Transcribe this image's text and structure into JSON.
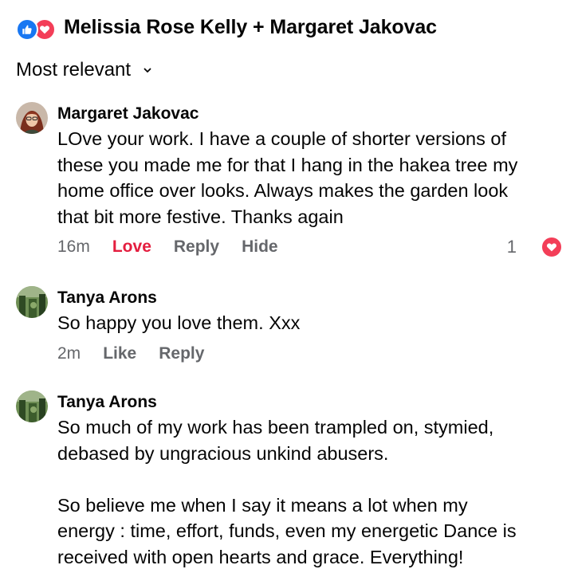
{
  "header": {
    "reactors": "Melissia Rose Kelly + Margaret Jakovac",
    "sort_label": "Most relevant",
    "icons": [
      "like-icon",
      "love-icon",
      "chevron-down-icon"
    ]
  },
  "comments": [
    {
      "author": "Margaret Jakovac",
      "text": "LOve your work. I have a couple of shorter versions of\nthese you made me for that I hang in the hakea tree my\nhome office over looks.  Always makes the garden look\nthat bit more festive. Thanks again",
      "time": "16m",
      "reaction_label": "Love",
      "reply_label": "Reply",
      "hide_label": "Hide",
      "reaction_count": "1"
    },
    {
      "author": "Tanya Arons",
      "text": "So happy you love them.  Xxx",
      "time": "2m",
      "reaction_label": "Like",
      "reply_label": "Reply"
    },
    {
      "author": "Tanya Arons",
      "text": "So much of my work has been trampled on, stymied,\ndebased by ungracious unkind abusers.\n\nSo believe me when I  say it means a lot when my\nenergy : time, effort, funds, even my energetic Dance is\nreceived with open hearts and grace. Everything!"
    }
  ],
  "colors": {
    "like_blue": "#1877f2",
    "love_red": "#f33e58",
    "love_text": "#e41e3f",
    "meta_gray": "#65676b"
  }
}
